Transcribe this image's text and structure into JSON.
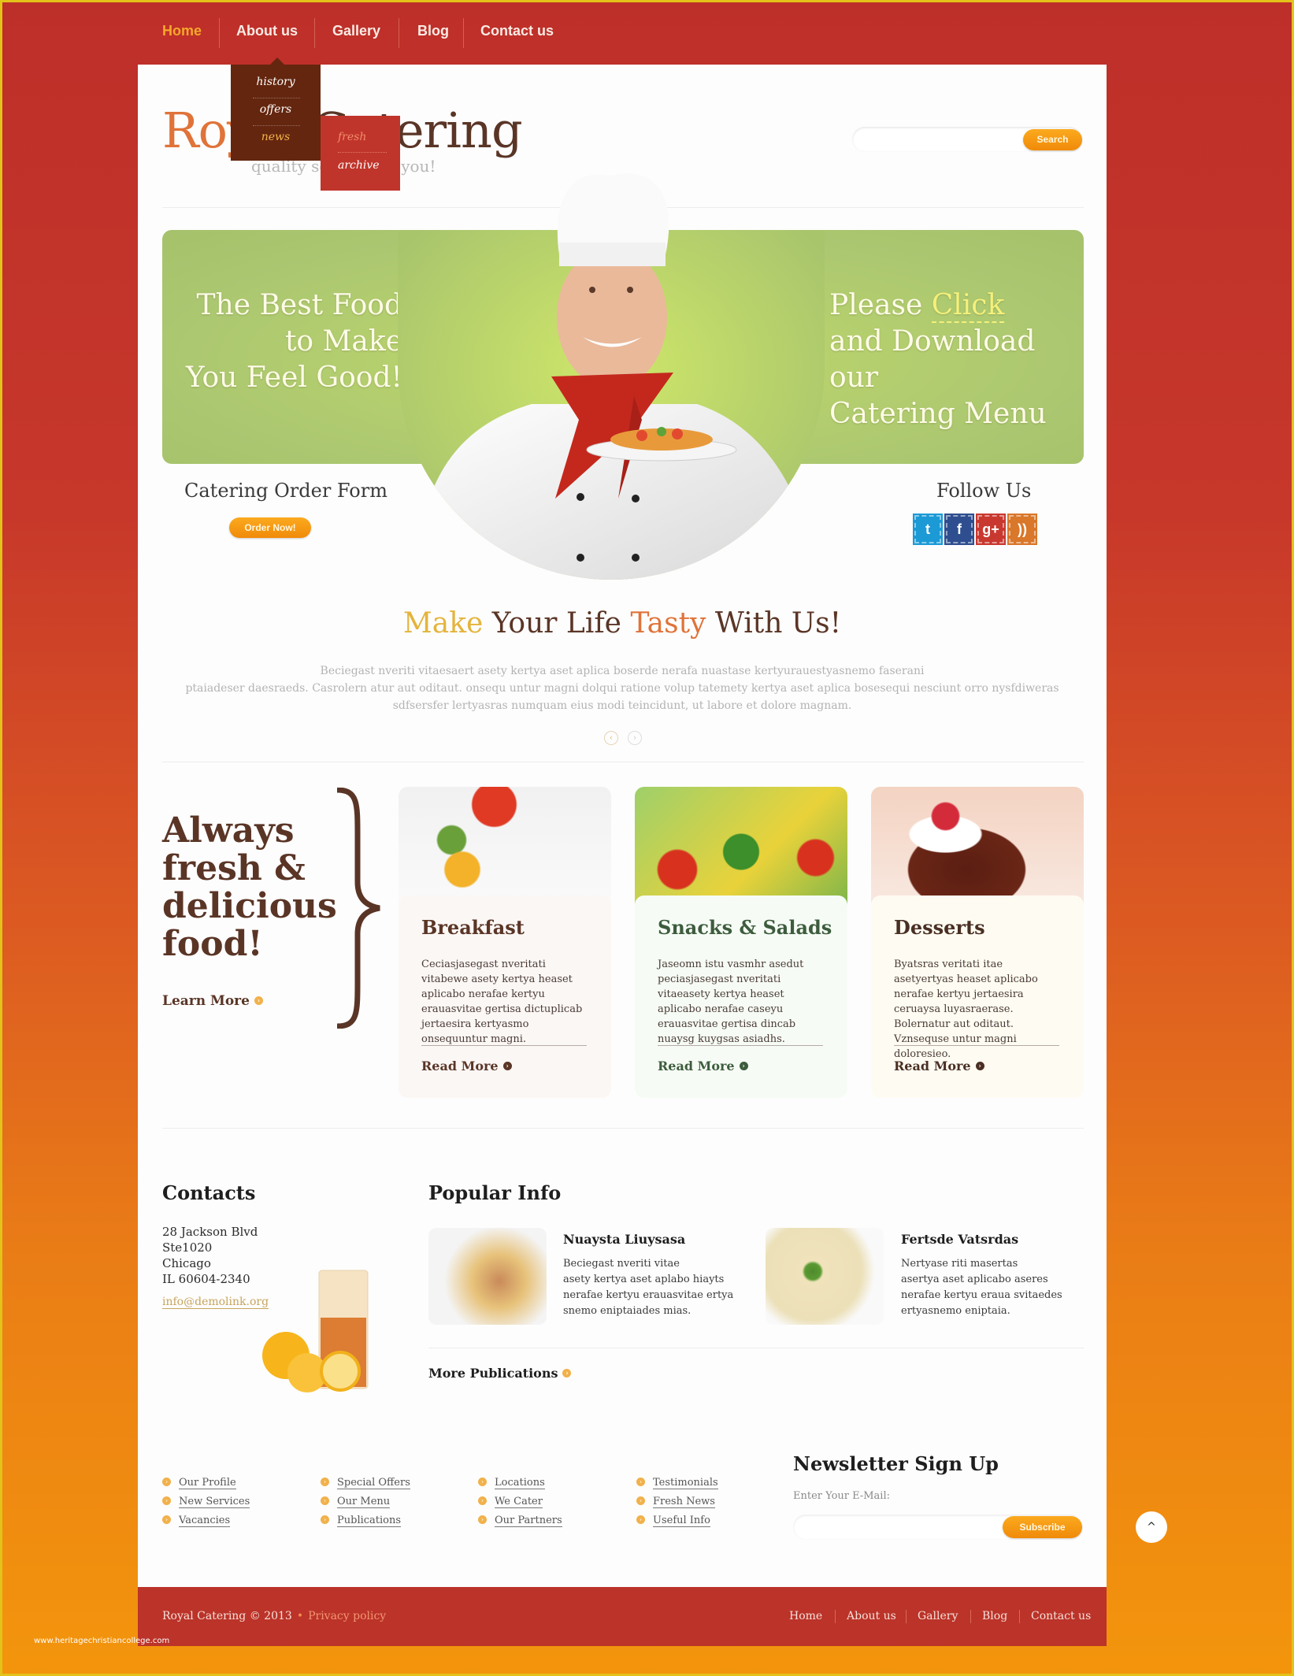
{
  "nav": {
    "items": [
      "Home",
      "About us",
      "Gallery",
      "Blog",
      "Contact us"
    ],
    "active": "Home",
    "dropdown": [
      "history",
      "offers",
      "news"
    ],
    "submenu": [
      "fresh",
      "archive"
    ]
  },
  "header": {
    "logo_first": "Royal",
    "logo_rest": " Catering",
    "tagline": "quality service for you!",
    "search_placeholder": "",
    "search_label": "Search"
  },
  "banner": {
    "left_lines": [
      "The Best Food",
      "to Make",
      "You Feel Good!"
    ],
    "right_prefix": "Please ",
    "right_link": "Click",
    "right_lines": [
      "and Download our",
      "Catering Menu"
    ]
  },
  "order": {
    "title": "Catering Order Form",
    "button": "Order Now!"
  },
  "follow": {
    "title": "Follow Us",
    "icons": [
      {
        "name": "twitter",
        "glyph": "t",
        "color": "#1b9ad6"
      },
      {
        "name": "facebook",
        "glyph": "f",
        "color": "#2e4e8f"
      },
      {
        "name": "google-plus",
        "glyph": "g+",
        "color": "#c9382f"
      },
      {
        "name": "rss",
        "glyph": "))",
        "color": "#d9772a"
      }
    ]
  },
  "tasty": {
    "w1": "Make",
    "w2": " Your Life ",
    "w3": "Tasty",
    "w4": " With Us!",
    "intro_lines": [
      "Beciegast nveriti vitaesaert asety kertya aset aplica boserde nerafa nuastase kertyurauestyasnemo faserani",
      "ptaiadeser daesraeds. Casrolern atur aut oditaut. onsequ untur magni dolqui ratione volup tatemety kertya aset aplica bosesequi nesciunt orro  nysfdiweras",
      "sdfsersfer lertyasras numquam eius modi teincidunt, ut labore et dolore magnam."
    ],
    "prev": "‹",
    "next": "›"
  },
  "fresh": {
    "lines": [
      "Always",
      "fresh &",
      "delicious",
      "food!"
    ],
    "learn_more": "Learn More"
  },
  "cards": [
    {
      "title": "Breakfast",
      "text": "Ceciasjasegast nveritati vitabewe asety kertya heaset aplicabo nerafae kertyu erauasvitae gertisa dictuplicab jertaesira kertyasmo onsequuntur magni.",
      "more": "Read More",
      "title_color": "#5a3526",
      "bg": "#fbf7f5"
    },
    {
      "title": "Snacks & Salads",
      "text": "Jaseomn istu vasmhr asedut peciasjasegast nveritati vitaeasety kertya heaset aplicabo nerafae caseyu erauasvitae gertisa dincab nuaysg kuygsas asiadhs.",
      "more": "Read More",
      "title_color": "#3d5c3d",
      "bg": "#f6fcf5"
    },
    {
      "title": "Desserts",
      "text": "Byatsras veritati itae asetyertyas heaset aplicabo nerafae kertyu jertaesira ceruaysa luyasraerase. Bolernatur aut oditaut. Vznsequse untur magni doloresieo.",
      "more": "Read More",
      "title_color": "#4a2f24",
      "bg": "#fefcf2"
    }
  ],
  "contacts": {
    "title": "Contacts",
    "address": [
      "28 Jackson Blvd",
      "Ste1020",
      "Chicago",
      "IL 60604-2340"
    ],
    "email": "info@demolink.org"
  },
  "popular": {
    "title": "Popular Info",
    "items": [
      {
        "title": "Nuaysta Liuysasa",
        "lines": [
          "Beciegast nveriti vitae",
          "asety kertya aset aplabo hiayts",
          "nerafae kertyu erauasvitae ertya",
          "snemo eniptaiades mias."
        ]
      },
      {
        "title": "Fertsde Vatsrdas",
        "lines": [
          "Nertyase riti masertas",
          "asertya aset aplicabo aseres",
          "nerafae kertyu eraua svitaedes",
          "ertyasnemo eniptaia."
        ]
      }
    ],
    "more": "More Publications"
  },
  "footer_links": [
    [
      "Our Profile",
      "New Services",
      "Vacancies"
    ],
    [
      "Special Offers",
      "Our Menu",
      "Publications"
    ],
    [
      "Locations",
      "We Cater",
      "Our Partners"
    ],
    [
      "Testimonials",
      "Fresh News",
      "Useful Info"
    ]
  ],
  "newsletter": {
    "title": "Newsletter Sign Up",
    "label": "Enter Your E-Mail:",
    "value": "",
    "button": "Subscribe"
  },
  "scroll_top": "^",
  "footer": {
    "copyright": "Royal Catering © 2013",
    "privacy": "Privacy policy",
    "nav": [
      "Home",
      "About us",
      "Gallery",
      "Blog",
      "Contact us"
    ]
  },
  "watermark": "www.heritagechristiancollege.com"
}
